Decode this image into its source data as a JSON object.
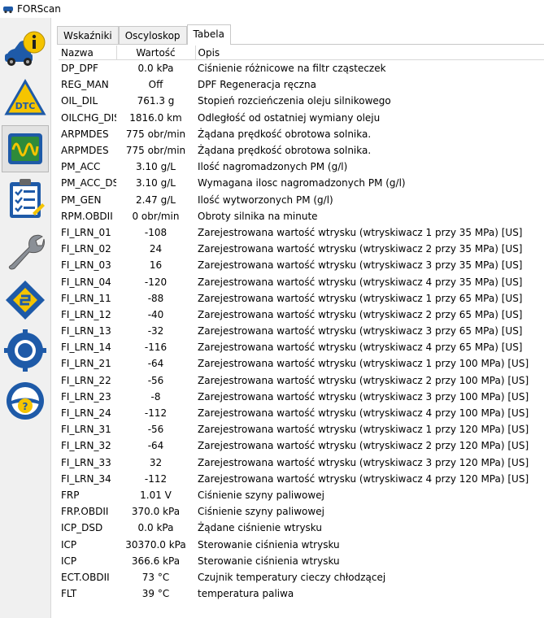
{
  "window": {
    "title": "FORScan"
  },
  "sidebar": {
    "items": [
      {
        "name": "info-icon"
      },
      {
        "name": "dtc-icon",
        "label": "DTC"
      },
      {
        "name": "oscilloscope-icon"
      },
      {
        "name": "checklist-icon"
      },
      {
        "name": "wrench-icon"
      },
      {
        "name": "chip-icon"
      },
      {
        "name": "settings-gear-icon"
      },
      {
        "name": "help-steering-icon"
      }
    ]
  },
  "tabs": [
    {
      "label": "Wskaźniki"
    },
    {
      "label": "Oscyloskop"
    },
    {
      "label": "Tabela",
      "active": true
    }
  ],
  "table": {
    "headers": [
      "Nazwa",
      "Wartość",
      "Opis"
    ],
    "rows": [
      {
        "name": "DP_DPF",
        "value": "0.0 kPa",
        "desc": "Ciśnienie różnicowe na filtr cząsteczek"
      },
      {
        "name": "REG_MAN",
        "value": "Off",
        "desc": "DPF Regeneracja ręczna"
      },
      {
        "name": "OIL_DIL",
        "value": "761.3 g",
        "desc": "Stopień rozcieńczenia oleju silnikowego"
      },
      {
        "name": "OILCHG_DIS",
        "value": "1816.0 km",
        "desc": "Odległość od ostatniej wymiany oleju"
      },
      {
        "name": "ARPMDES",
        "value": "775 obr/min",
        "desc": "Żądana prędkość obrotowa solnika."
      },
      {
        "name": "ARPMDES",
        "value": "775 obr/min",
        "desc": "Żądana prędkość obrotowa solnika."
      },
      {
        "name": "PM_ACC",
        "value": "3.10 g/L",
        "desc": "Ilość nagromadzonych PM (g/l)"
      },
      {
        "name": "PM_ACC_DS",
        "value": "3.10 g/L",
        "desc": "Wymagana ilosc nagromadzonych PM (g/l)"
      },
      {
        "name": "PM_GEN",
        "value": "2.47 g/L",
        "desc": "Ilość wytworzonych PM (g/l)"
      },
      {
        "name": "RPM.OBDII",
        "value": "0 obr/min",
        "desc": "Obroty silnika na minute"
      },
      {
        "name": "FI_LRN_01",
        "value": "-108",
        "desc": "Zarejestrowana wartość wtrysku (wtryskiwacz 1 przy 35 MPa) [US]"
      },
      {
        "name": "FI_LRN_02",
        "value": "24",
        "desc": "Zarejestrowana wartość wtrysku (wtryskiwacz 2 przy 35 MPa) [US]"
      },
      {
        "name": "FI_LRN_03",
        "value": "16",
        "desc": "Zarejestrowana wartość wtrysku (wtryskiwacz 3 przy 35 MPa) [US]"
      },
      {
        "name": "FI_LRN_04",
        "value": "-120",
        "desc": "Zarejestrowana wartość wtrysku (wtryskiwacz 4 przy 35 MPa) [US]"
      },
      {
        "name": "FI_LRN_11",
        "value": "-88",
        "desc": "Zarejestrowana wartość wtrysku (wtryskiwacz 1 przy 65 MPa) [US]"
      },
      {
        "name": "FI_LRN_12",
        "value": "-40",
        "desc": "Zarejestrowana wartość wtrysku (wtryskiwacz 2 przy 65 MPa) [US]"
      },
      {
        "name": "FI_LRN_13",
        "value": "-32",
        "desc": "Zarejestrowana wartość wtrysku (wtryskiwacz 3 przy 65 MPa) [US]"
      },
      {
        "name": "FI_LRN_14",
        "value": "-116",
        "desc": "Zarejestrowana wartość wtrysku (wtryskiwacz 4 przy 65 MPa) [US]"
      },
      {
        "name": "FI_LRN_21",
        "value": "-64",
        "desc": "Zarejestrowana wartość wtrysku (wtryskiwacz 1 przy 100 MPa) [US]"
      },
      {
        "name": "FI_LRN_22",
        "value": "-56",
        "desc": "Zarejestrowana wartość wtrysku (wtryskiwacz 2 przy 100 MPa) [US]"
      },
      {
        "name": "FI_LRN_23",
        "value": "-8",
        "desc": "Zarejestrowana wartość wtrysku (wtryskiwacz 3 przy 100 MPa) [US]"
      },
      {
        "name": "FI_LRN_24",
        "value": "-112",
        "desc": "Zarejestrowana wartość wtrysku (wtryskiwacz 4 przy 100 MPa) [US]"
      },
      {
        "name": "FI_LRN_31",
        "value": "-56",
        "desc": "Zarejestrowana wartość wtrysku (wtryskiwacz 1 przy 120 MPa) [US]"
      },
      {
        "name": "FI_LRN_32",
        "value": "-64",
        "desc": "Zarejestrowana wartość wtrysku (wtryskiwacz 2 przy 120 MPa) [US]"
      },
      {
        "name": "FI_LRN_33",
        "value": "32",
        "desc": "Zarejestrowana wartość wtrysku (wtryskiwacz 3 przy 120 MPa) [US]"
      },
      {
        "name": "FI_LRN_34",
        "value": "-112",
        "desc": "Zarejestrowana wartość wtrysku (wtryskiwacz 4 przy 120 MPa) [US]"
      },
      {
        "name": "FRP",
        "value": "1.01 V",
        "desc": "Ciśnienie szyny paliwowej"
      },
      {
        "name": "FRP.OBDII",
        "value": "370.0 kPa",
        "desc": "Ciśnienie szyny paliwowej"
      },
      {
        "name": "ICP_DSD",
        "value": "0.0 kPa",
        "desc": "Żądane ciśnienie wtrysku"
      },
      {
        "name": "ICP",
        "value": "30370.0 kPa",
        "desc": "Sterowanie ciśnienia wtrysku"
      },
      {
        "name": "ICP",
        "value": "366.6 kPa",
        "desc": "Sterowanie ciśnienia wtrysku"
      },
      {
        "name": "ECT.OBDII",
        "value": "73 °C",
        "desc": "Czujnik temperatury cieczy chłodzącej"
      },
      {
        "name": "FLT",
        "value": "39 °C",
        "desc": "temperatura paliwa"
      }
    ]
  },
  "colors": {
    "sidebar_bg": "#f0f0f0",
    "header_border": "#d8d8d8",
    "icon_blue": "#1e5aa8",
    "icon_yellow": "#f5c400",
    "icon_green": "#2e8b3a"
  }
}
